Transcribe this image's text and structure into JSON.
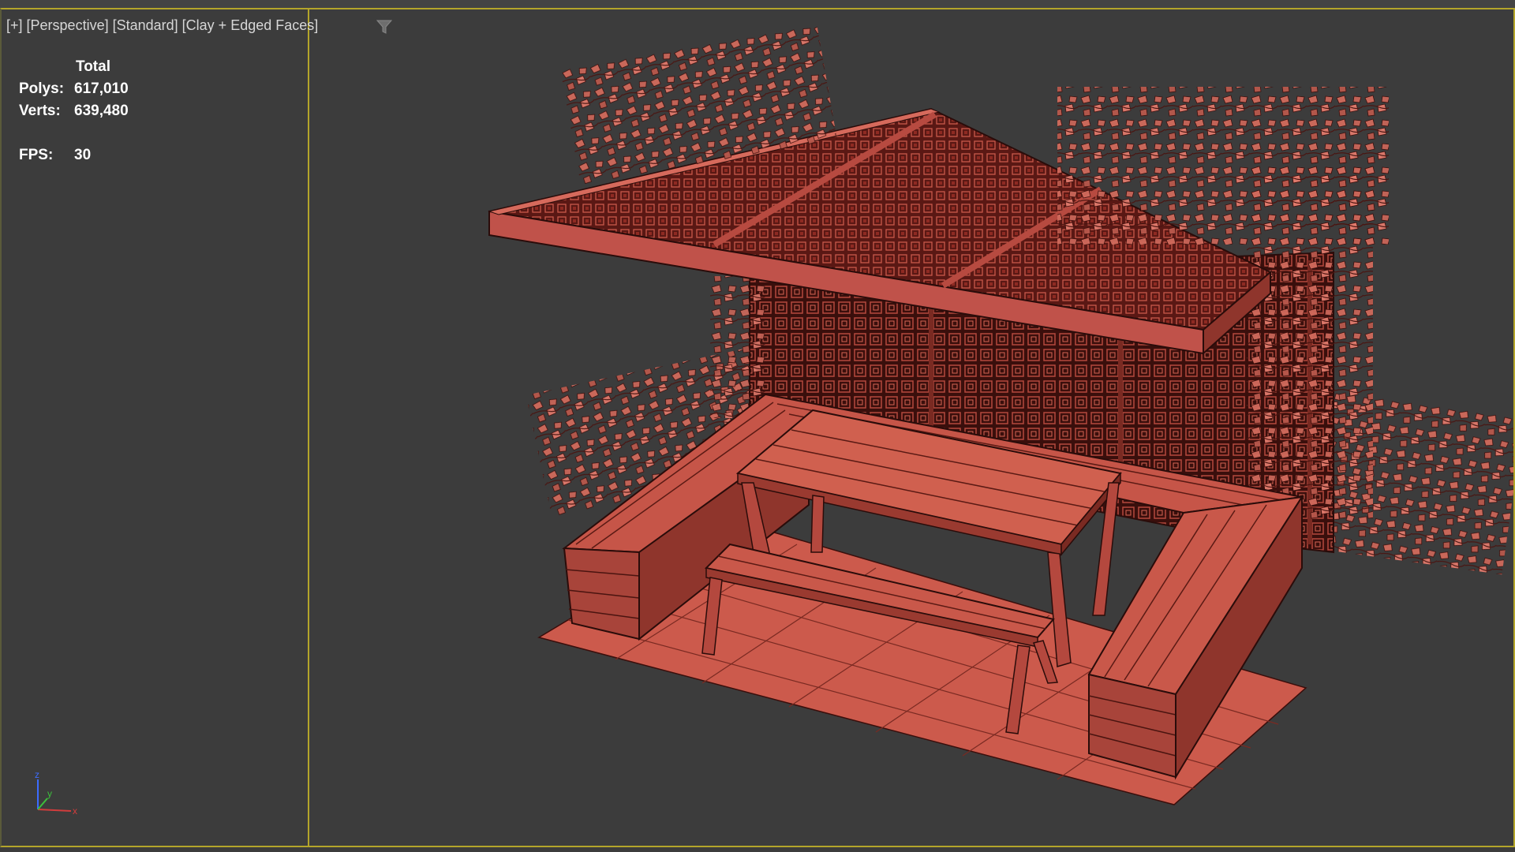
{
  "viewport": {
    "labels": {
      "plus": "[+]",
      "view": "[Perspective]",
      "shading": "[Standard]",
      "style": "[Clay + Edged Faces]"
    },
    "filter_icon": "filter-funnel-icon",
    "stats": {
      "header": "Total",
      "polys_label": "Polys:",
      "polys_value": "617,010",
      "verts_label": "Verts:",
      "verts_value": "639,480",
      "fps_label": "FPS:",
      "fps_value": "30"
    },
    "gizmo": {
      "x_label": "x",
      "y_label": "y",
      "z_label": "z",
      "colors": {
        "x": "#d23c3c",
        "y": "#3cbf3c",
        "z": "#3c6cff"
      }
    },
    "colors": {
      "background": "#3c3c3c",
      "active_border": "#b4a52a",
      "clay": "#c9584a",
      "clay_dark": "#6b1c17",
      "edge": "#2a0c0a"
    }
  }
}
